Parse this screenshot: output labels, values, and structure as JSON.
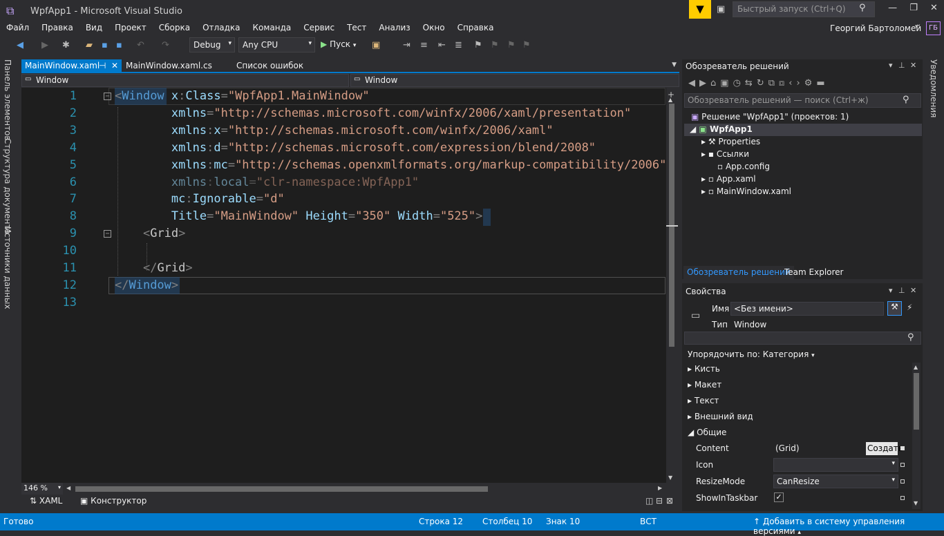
{
  "window": {
    "title": "WpfApp1 - Microsoft Visual Studio",
    "quick_launch_placeholder": "Быстрый запуск (Ctrl+Q)",
    "user_name": "Георгий Бартоломей",
    "user_initials": "ГБ"
  },
  "menu": [
    "Файл",
    "Правка",
    "Вид",
    "Проект",
    "Сборка",
    "Отладка",
    "Команда",
    "Сервис",
    "Тест",
    "Анализ",
    "Окно",
    "Справка"
  ],
  "toolbar": {
    "config": "Debug",
    "platform": "Any CPU",
    "run_label": "Пуск"
  },
  "left_tabs": [
    "Панель элементов",
    "Структура документа",
    "Источники данных"
  ],
  "doc_tabs": [
    "MainWindow.xaml",
    "MainWindow.xaml.cs",
    "Список ошибок"
  ],
  "nav": {
    "left": "Window",
    "right": "Window"
  },
  "code_lines": [
    {
      "n": "1",
      "html": "<span class='p'>&lt;</span><span class='t'>Window</span> <span class='a'>x</span><span class='p'>:</span><span class='a'>Class</span><span class='p'>=</span><span class='s'>\"WpfApp1.MainWindow\"</span>"
    },
    {
      "n": "2",
      "html": "        <span class='a'>xmlns</span><span class='p'>=</span><span class='s'>\"http://schemas.microsoft.com/winfx/2006/xaml/presentation\"</span>"
    },
    {
      "n": "3",
      "html": "        <span class='a'>xmlns</span><span class='p'>:</span><span class='a'>x</span><span class='p'>=</span><span class='s'>\"http://schemas.microsoft.com/winfx/2006/xaml\"</span>"
    },
    {
      "n": "4",
      "html": "        <span class='a'>xmlns</span><span class='p'>:</span><span class='a'>d</span><span class='p'>=</span><span class='s'>\"http://schemas.microsoft.com/expression/blend/2008\"</span>"
    },
    {
      "n": "5",
      "html": "        <span class='a'>xmlns</span><span class='p'>:</span><span class='a'>mc</span><span class='p'>=</span><span class='s'>\"http://schemas.openxmlformats.org/markup-compatibility/2006\"</span>"
    },
    {
      "n": "6",
      "html": "<span class='dim'>        <span class='a'>xmlns</span><span class='p'>:</span><span class='a'>local</span><span class='p'>=</span><span class='s'>\"clr-namespace:WpfApp1\"</span></span>"
    },
    {
      "n": "7",
      "html": "        <span class='a'>mc</span><span class='p'>:</span><span class='a'>Ignorable</span><span class='p'>=</span><span class='s'>\"d\"</span>"
    },
    {
      "n": "8",
      "html": "        <span class='a'>Title</span><span class='p'>=</span><span class='s'>\"MainWindow\"</span> <span class='a'>Height</span><span class='p'>=</span><span class='s'>\"350\"</span> <span class='a'>Width</span><span class='p'>=</span><span class='s'>\"525\"</span><span class='p'>&gt;</span>"
    },
    {
      "n": "9",
      "html": "    <span class='p'>&lt;</span><span class='cl'>Grid</span><span class='p'>&gt;</span>"
    },
    {
      "n": "10",
      "html": ""
    },
    {
      "n": "11",
      "html": "    <span class='p'>&lt;/</span><span class='cl'>Grid</span><span class='p'>&gt;</span>"
    },
    {
      "n": "12",
      "html": "<span class='p'>&lt;/</span><span class='t'>Window</span><span class='p'>&gt;</span>"
    },
    {
      "n": "13",
      "html": ""
    }
  ],
  "zoom": "146 %",
  "view_tabs": {
    "xaml": "XAML",
    "designer": "Конструктор"
  },
  "solution": {
    "title": "Обозреватель решений",
    "search_placeholder": "Обозреватель решений — поиск (Ctrl+ж)",
    "solution_label": "Решение \"WpfApp1\"  (проектов: 1)",
    "project": "WpfApp1",
    "items": [
      "Properties",
      "Ссылки",
      "App.config",
      "App.xaml",
      "MainWindow.xaml"
    ],
    "tab_active": "Обозреватель решений",
    "tab_other": "Team Explorer"
  },
  "properties": {
    "title": "Свойства",
    "name_label": "Имя",
    "name_value": "<Без имени>",
    "type_label": "Тип",
    "type_value": "Window",
    "sort_label": "Упорядочить по: Категория",
    "categories": [
      "Кисть",
      "Макет",
      "Текст",
      "Внешний вид",
      "Общие"
    ],
    "rows": [
      {
        "name": "Content",
        "value": "(Grid)",
        "button": "Создать"
      },
      {
        "name": "Icon",
        "value": ""
      },
      {
        "name": "ResizeMode",
        "value": "CanResize"
      },
      {
        "name": "ShowInTaskbar",
        "value": "✓"
      }
    ]
  },
  "right_tab": "Уведомления",
  "status": {
    "ready": "Готово",
    "row": "Строка 12",
    "col": "Столбец 10",
    "char": "Знак 10",
    "mode": "ВСТ",
    "source_control": "Добавить в систему управления версиями"
  },
  "colors": {
    "accent": "#007acc",
    "editor_bg": "#1e1e1e",
    "tag": "#569cd6",
    "attr": "#9cdcfe",
    "string": "#d69d85",
    "line_numbers": "#2b91af"
  }
}
